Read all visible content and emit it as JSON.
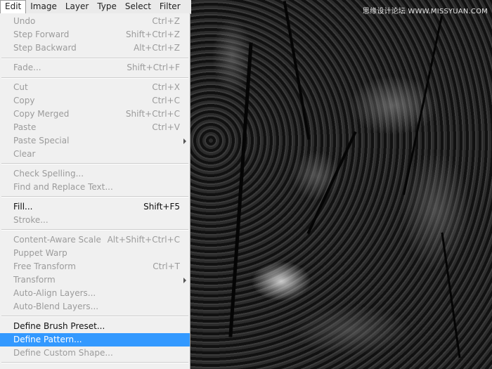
{
  "menubar": {
    "items": [
      "Edit",
      "Image",
      "Layer",
      "Type",
      "Select",
      "Filter"
    ],
    "active": "Edit"
  },
  "edit_menu": {
    "items": [
      {
        "label": "Undo",
        "shortcut": "Ctrl+Z",
        "enabled": false
      },
      {
        "label": "Step Forward",
        "shortcut": "Shift+Ctrl+Z",
        "enabled": false
      },
      {
        "label": "Step Backward",
        "shortcut": "Alt+Ctrl+Z",
        "enabled": false
      },
      {
        "label": "Fade...",
        "shortcut": "Shift+Ctrl+F",
        "enabled": false
      },
      {
        "label": "Cut",
        "shortcut": "Ctrl+X",
        "enabled": false
      },
      {
        "label": "Copy",
        "shortcut": "Ctrl+C",
        "enabled": false
      },
      {
        "label": "Copy Merged",
        "shortcut": "Shift+Ctrl+C",
        "enabled": false
      },
      {
        "label": "Paste",
        "shortcut": "Ctrl+V",
        "enabled": false
      },
      {
        "label": "Paste Special",
        "shortcut": "",
        "enabled": false,
        "submenu": true
      },
      {
        "label": "Clear",
        "shortcut": "",
        "enabled": false
      },
      {
        "label": "Check Spelling...",
        "shortcut": "",
        "enabled": false
      },
      {
        "label": "Find and Replace Text...",
        "shortcut": "",
        "enabled": false
      },
      {
        "label": "Fill...",
        "shortcut": "Shift+F5",
        "enabled": true
      },
      {
        "label": "Stroke...",
        "shortcut": "",
        "enabled": false
      },
      {
        "label": "Content-Aware Scale",
        "shortcut": "Alt+Shift+Ctrl+C",
        "enabled": false
      },
      {
        "label": "Puppet Warp",
        "shortcut": "",
        "enabled": false
      },
      {
        "label": "Free Transform",
        "shortcut": "Ctrl+T",
        "enabled": false
      },
      {
        "label": "Transform",
        "shortcut": "",
        "enabled": false,
        "submenu": true
      },
      {
        "label": "Auto-Align Layers...",
        "shortcut": "",
        "enabled": false
      },
      {
        "label": "Auto-Blend Layers...",
        "shortcut": "",
        "enabled": false
      },
      {
        "label": "Define Brush Preset...",
        "shortcut": "",
        "enabled": true
      },
      {
        "label": "Define Pattern...",
        "shortcut": "",
        "enabled": true,
        "highlighted": true
      },
      {
        "label": "Define Custom Shape...",
        "shortcut": "",
        "enabled": false
      }
    ]
  },
  "watermark": "思缘设计论坛 WWW.MISSYUAN.COM",
  "colors": {
    "menu_bg": "#f0f0f0",
    "highlight": "#3399ff",
    "disabled_text": "#9b9b9b",
    "enabled_text": "#111111"
  }
}
